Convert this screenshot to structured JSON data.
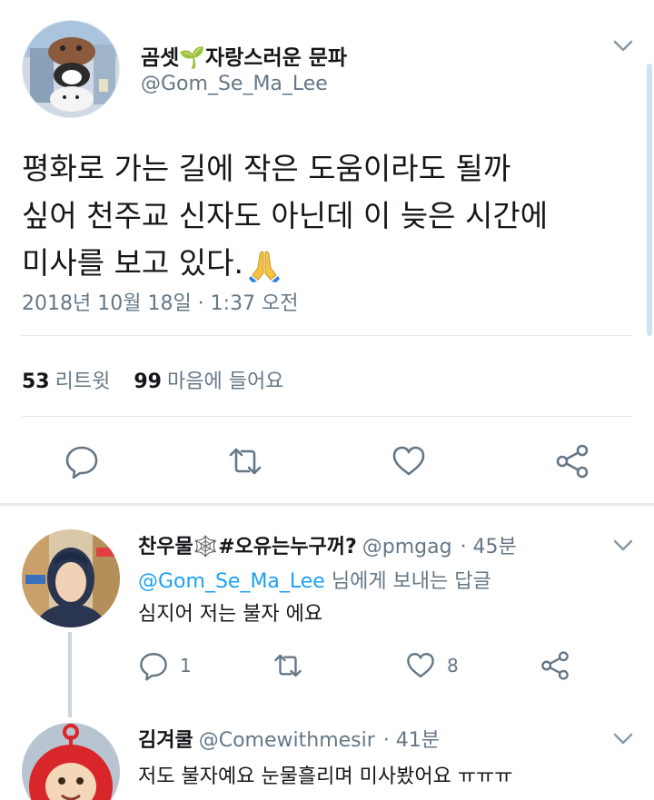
{
  "tweet": {
    "display_name": "곰셋🌱자랑스러운 문파",
    "handle": "@Gom_Se_Ma_Lee",
    "text_lines": [
      "평화로 가는 길에 작은 도움이라도 될까",
      "싶어 천주교 신자도 아닌데 이 늦은 시간에",
      "미사를 보고 있다."
    ],
    "timestamp": "2018년 10월 18일 · 1:37 오전",
    "retweet_count": "53",
    "retweet_label": "리트윗",
    "like_count": "99",
    "like_label": "마음에 들어요",
    "icons": [
      "reply-icon",
      "retweet-icon",
      "like-icon",
      "share-icon",
      "chevron-down-icon",
      "folded-hands-emoji"
    ]
  },
  "replies": [
    {
      "display_name": "찬우물🕸️#오유는누구꺼?",
      "handle": "@pmgag",
      "time": "· 45분",
      "replying_to": "@Gom_Se_Ma_Lee",
      "replying_suffix": " 님에게 보내는 답글",
      "text": "심지어 저는 불자 에요",
      "reply_count": "1",
      "like_count": "8"
    },
    {
      "display_name": "김겨쿨",
      "handle": "@Comewithmesir",
      "time": "· 41분",
      "text": "저도 불자예요 눈물흘리며 미사봤어요 ㅠㅠㅠ"
    }
  ],
  "colors": {
    "accent": "#1da1f2",
    "secondary_text": "#657786",
    "divider": "#e1e8ed"
  }
}
